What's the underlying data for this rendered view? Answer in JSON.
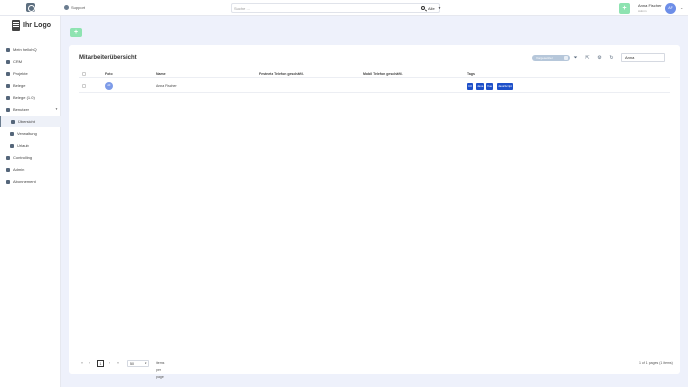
{
  "topbar": {
    "support_label": "Support",
    "search": {
      "placeholder": "Suche ...",
      "scope": "Alle"
    },
    "add_label": "+",
    "user": {
      "name": "Anna Fischer",
      "role": "Admin",
      "initials": "AF"
    }
  },
  "sidebar": {
    "brand": "Ihr Logo",
    "items": [
      {
        "label": "Mein hellohQ"
      },
      {
        "label": "CRM"
      },
      {
        "label": "Projekte"
      },
      {
        "label": "Belege"
      },
      {
        "label": "Belege (1.0)"
      },
      {
        "label": "Benutzer",
        "expanded": true
      },
      {
        "label": "Übersicht",
        "active": true
      },
      {
        "label": "Verwaltung"
      },
      {
        "label": "Urlaub"
      },
      {
        "label": "Controlling"
      },
      {
        "label": "Admin"
      },
      {
        "label": "Abonnement"
      }
    ]
  },
  "main": {
    "add_label": "+",
    "title": "Mitarbeiterübersicht",
    "filter_chip": "Vorgesetzter",
    "search_value": "Anna",
    "columns": [
      "Foto",
      "Name",
      "Festnetz Telefon geschäftl.",
      "Mobil Telefon geschäftl.",
      "Tags"
    ],
    "rows": [
      {
        "initials": "AF",
        "name": "Anna Fischer",
        "landline": "",
        "mobile": "",
        "tags": [
          "C#",
          "Java",
          "Vue",
          "JavaScript"
        ]
      }
    ],
    "pagination": {
      "first": "«",
      "prev": "‹",
      "current_page": "1",
      "next": "›",
      "last": "»",
      "page_size": "50",
      "items_per_page_label": "items per page",
      "info": "1 of 1 pages (1 items)"
    }
  },
  "colors": {
    "accent_green": "#8ee3b1",
    "tag_blue": "#1d4fc9",
    "avatar_blue": "#6d8ee8"
  }
}
